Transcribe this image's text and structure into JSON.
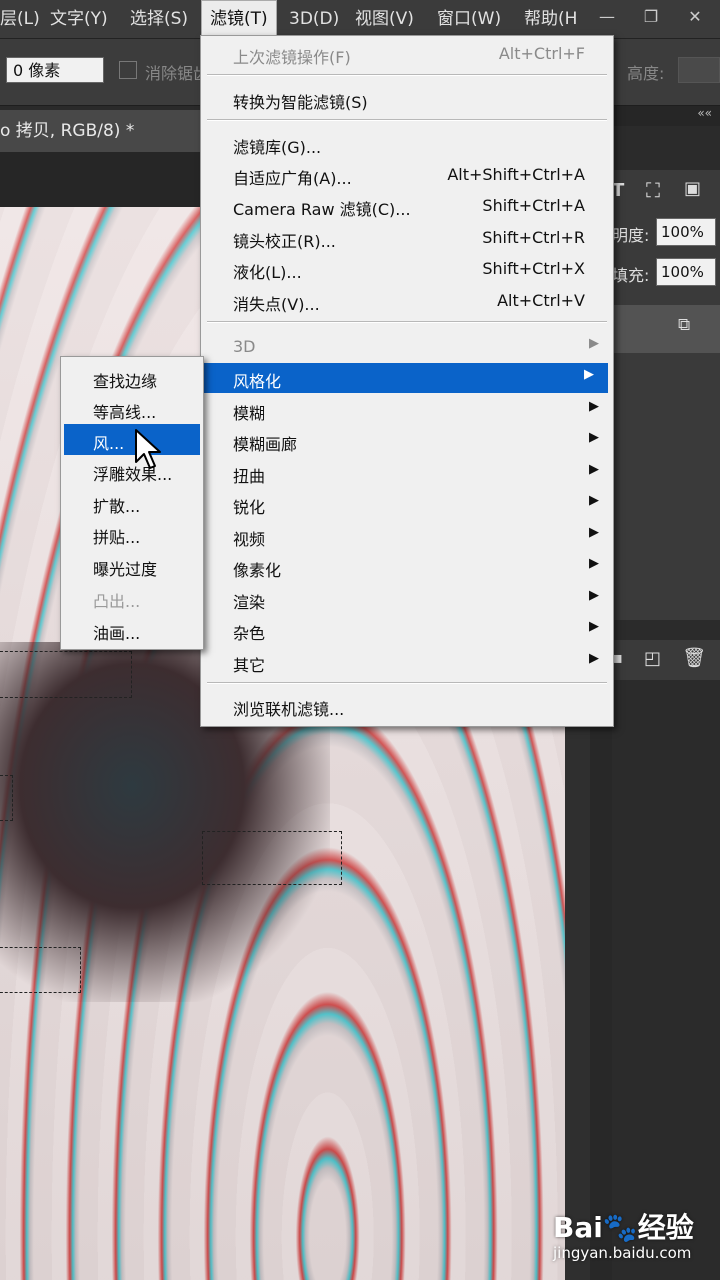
{
  "menubar": {
    "items": [
      "层(L)",
      "文字(Y)",
      "选择(S)",
      "滤镜(T)",
      "3D(D)",
      "视图(V)",
      "窗口(W)",
      "帮助(H"
    ],
    "window_controls": [
      "—",
      "❐",
      "✕"
    ]
  },
  "options": {
    "feather_value": "0 像素",
    "antialias_label": "消除锯齿",
    "height_label": "高度:"
  },
  "document": {
    "tab_title": "o 拷贝, RGB/8) *"
  },
  "panels": {
    "opacity_label": "明度:",
    "opacity_value": "100%",
    "fill_label": "填充:",
    "fill_value": "100%",
    "collapse_icon": "««"
  },
  "filter_menu": {
    "items": [
      {
        "label": "上次滤镜操作(F)",
        "shortcut": "Alt+Ctrl+F",
        "disabled": true
      },
      {
        "label": "转换为智能滤镜(S)",
        "shortcut": ""
      },
      {
        "label": "滤镜库(G)...",
        "shortcut": ""
      },
      {
        "label": "自适应广角(A)...",
        "shortcut": "Alt+Shift+Ctrl+A"
      },
      {
        "label": "Camera Raw 滤镜(C)...",
        "shortcut": "Shift+Ctrl+A"
      },
      {
        "label": "镜头校正(R)...",
        "shortcut": "Shift+Ctrl+R"
      },
      {
        "label": "液化(L)...",
        "shortcut": "Shift+Ctrl+X"
      },
      {
        "label": "消失点(V)...",
        "shortcut": "Alt+Ctrl+V"
      },
      {
        "label": "3D",
        "submenu": true,
        "disabled": true
      },
      {
        "label": "风格化",
        "submenu": true,
        "selected": true
      },
      {
        "label": "模糊",
        "submenu": true
      },
      {
        "label": "模糊画廊",
        "submenu": true
      },
      {
        "label": "扭曲",
        "submenu": true
      },
      {
        "label": "锐化",
        "submenu": true
      },
      {
        "label": "视频",
        "submenu": true
      },
      {
        "label": "像素化",
        "submenu": true
      },
      {
        "label": "渲染",
        "submenu": true
      },
      {
        "label": "杂色",
        "submenu": true
      },
      {
        "label": "其它",
        "submenu": true
      },
      {
        "label": "浏览联机滤镜...",
        "shortcut": ""
      }
    ],
    "arrow_glyph": "▶"
  },
  "stylize_submenu": {
    "items": [
      {
        "label": "查找边缘"
      },
      {
        "label": "等高线..."
      },
      {
        "label": "风...",
        "selected": true
      },
      {
        "label": "浮雕效果..."
      },
      {
        "label": "扩散..."
      },
      {
        "label": "拼贴..."
      },
      {
        "label": "曝光过度"
      },
      {
        "label": "凸出...",
        "disabled": true
      },
      {
        "label": "油画..."
      }
    ]
  },
  "watermark": {
    "logo": "Bai🐾经验",
    "url": "jingyan.baidu.com"
  },
  "colors": {
    "menu_highlight": "#0a63c9",
    "menu_bg": "#f0f0f0",
    "app_bg": "#282828"
  }
}
